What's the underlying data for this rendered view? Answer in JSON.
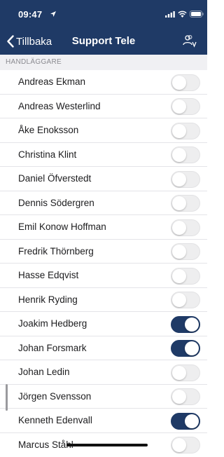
{
  "status_bar": {
    "time": "09:47"
  },
  "nav": {
    "back_label": "Tillbaka",
    "title": "Support Tele"
  },
  "section": {
    "title": "HANDLÄGGARE"
  },
  "colors": {
    "header_bg": "#1f3a66",
    "toggle_on": "#1f3a66",
    "toggle_off": "#eeeeef"
  },
  "icons": [
    "location-arrow-icon",
    "signal-icon",
    "wifi-icon",
    "battery-icon",
    "chevron-left-icon",
    "people-icon"
  ],
  "handlers": [
    {
      "name": "Andreas Ekman",
      "enabled": false
    },
    {
      "name": "Andreas Westerlind",
      "enabled": false
    },
    {
      "name": "Åke Enoksson",
      "enabled": false
    },
    {
      "name": "Christina Klint",
      "enabled": false
    },
    {
      "name": "Daniel Öfverstedt",
      "enabled": false
    },
    {
      "name": "Dennis Södergren",
      "enabled": false
    },
    {
      "name": "Emil Konow Hoffman",
      "enabled": false
    },
    {
      "name": "Fredrik Thörnberg",
      "enabled": false
    },
    {
      "name": "Hasse Edqvist",
      "enabled": false
    },
    {
      "name": "Henrik Ryding",
      "enabled": false
    },
    {
      "name": "Joakim Hedberg",
      "enabled": true
    },
    {
      "name": "Johan Forsmark",
      "enabled": true
    },
    {
      "name": "Johan Ledin",
      "enabled": false
    },
    {
      "name": "Jörgen Svensson",
      "enabled": false
    },
    {
      "name": "Kenneth Edenvall",
      "enabled": true
    },
    {
      "name": "Marcus Ståhl",
      "enabled": false
    }
  ]
}
